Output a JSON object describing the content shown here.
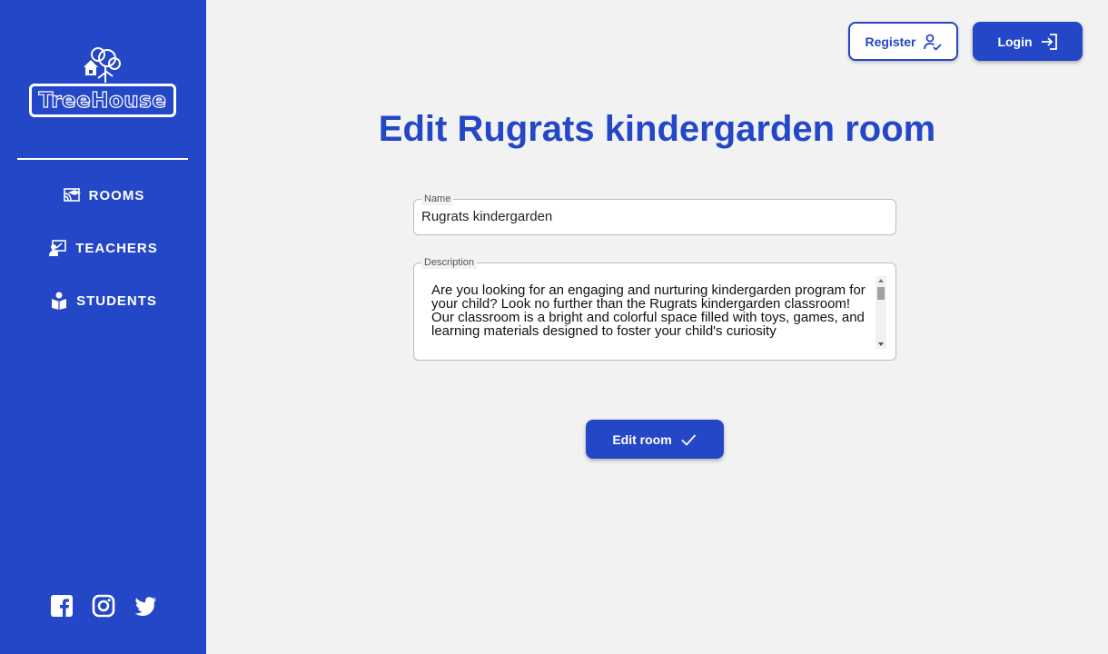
{
  "colors": {
    "primary": "#2447c8",
    "background": "#f2f2f2",
    "white": "#ffffff"
  },
  "sidebar": {
    "logo_text": "TreeHouse",
    "items": [
      {
        "label": "ROOMS",
        "icon": "rooms-icon"
      },
      {
        "label": "TEACHERS",
        "icon": "teachers-icon"
      },
      {
        "label": "STUDENTS",
        "icon": "students-icon"
      }
    ],
    "socials": [
      "facebook-icon",
      "instagram-icon",
      "twitter-icon"
    ]
  },
  "header": {
    "register_label": "Register",
    "login_label": "Login"
  },
  "main": {
    "title": "Edit Rugrats kindergarden room",
    "name_field": {
      "label": "Name",
      "value": "Rugrats kindergarden"
    },
    "description_field": {
      "label": "Description",
      "value": "Are you looking for an engaging and nurturing kindergarden program for your child? Look no further than the Rugrats kindergarden classroom!\nOur classroom is a bright and colorful space filled with toys, games, and learning materials designed to foster your child's curiosity"
    },
    "submit_label": "Edit room"
  }
}
